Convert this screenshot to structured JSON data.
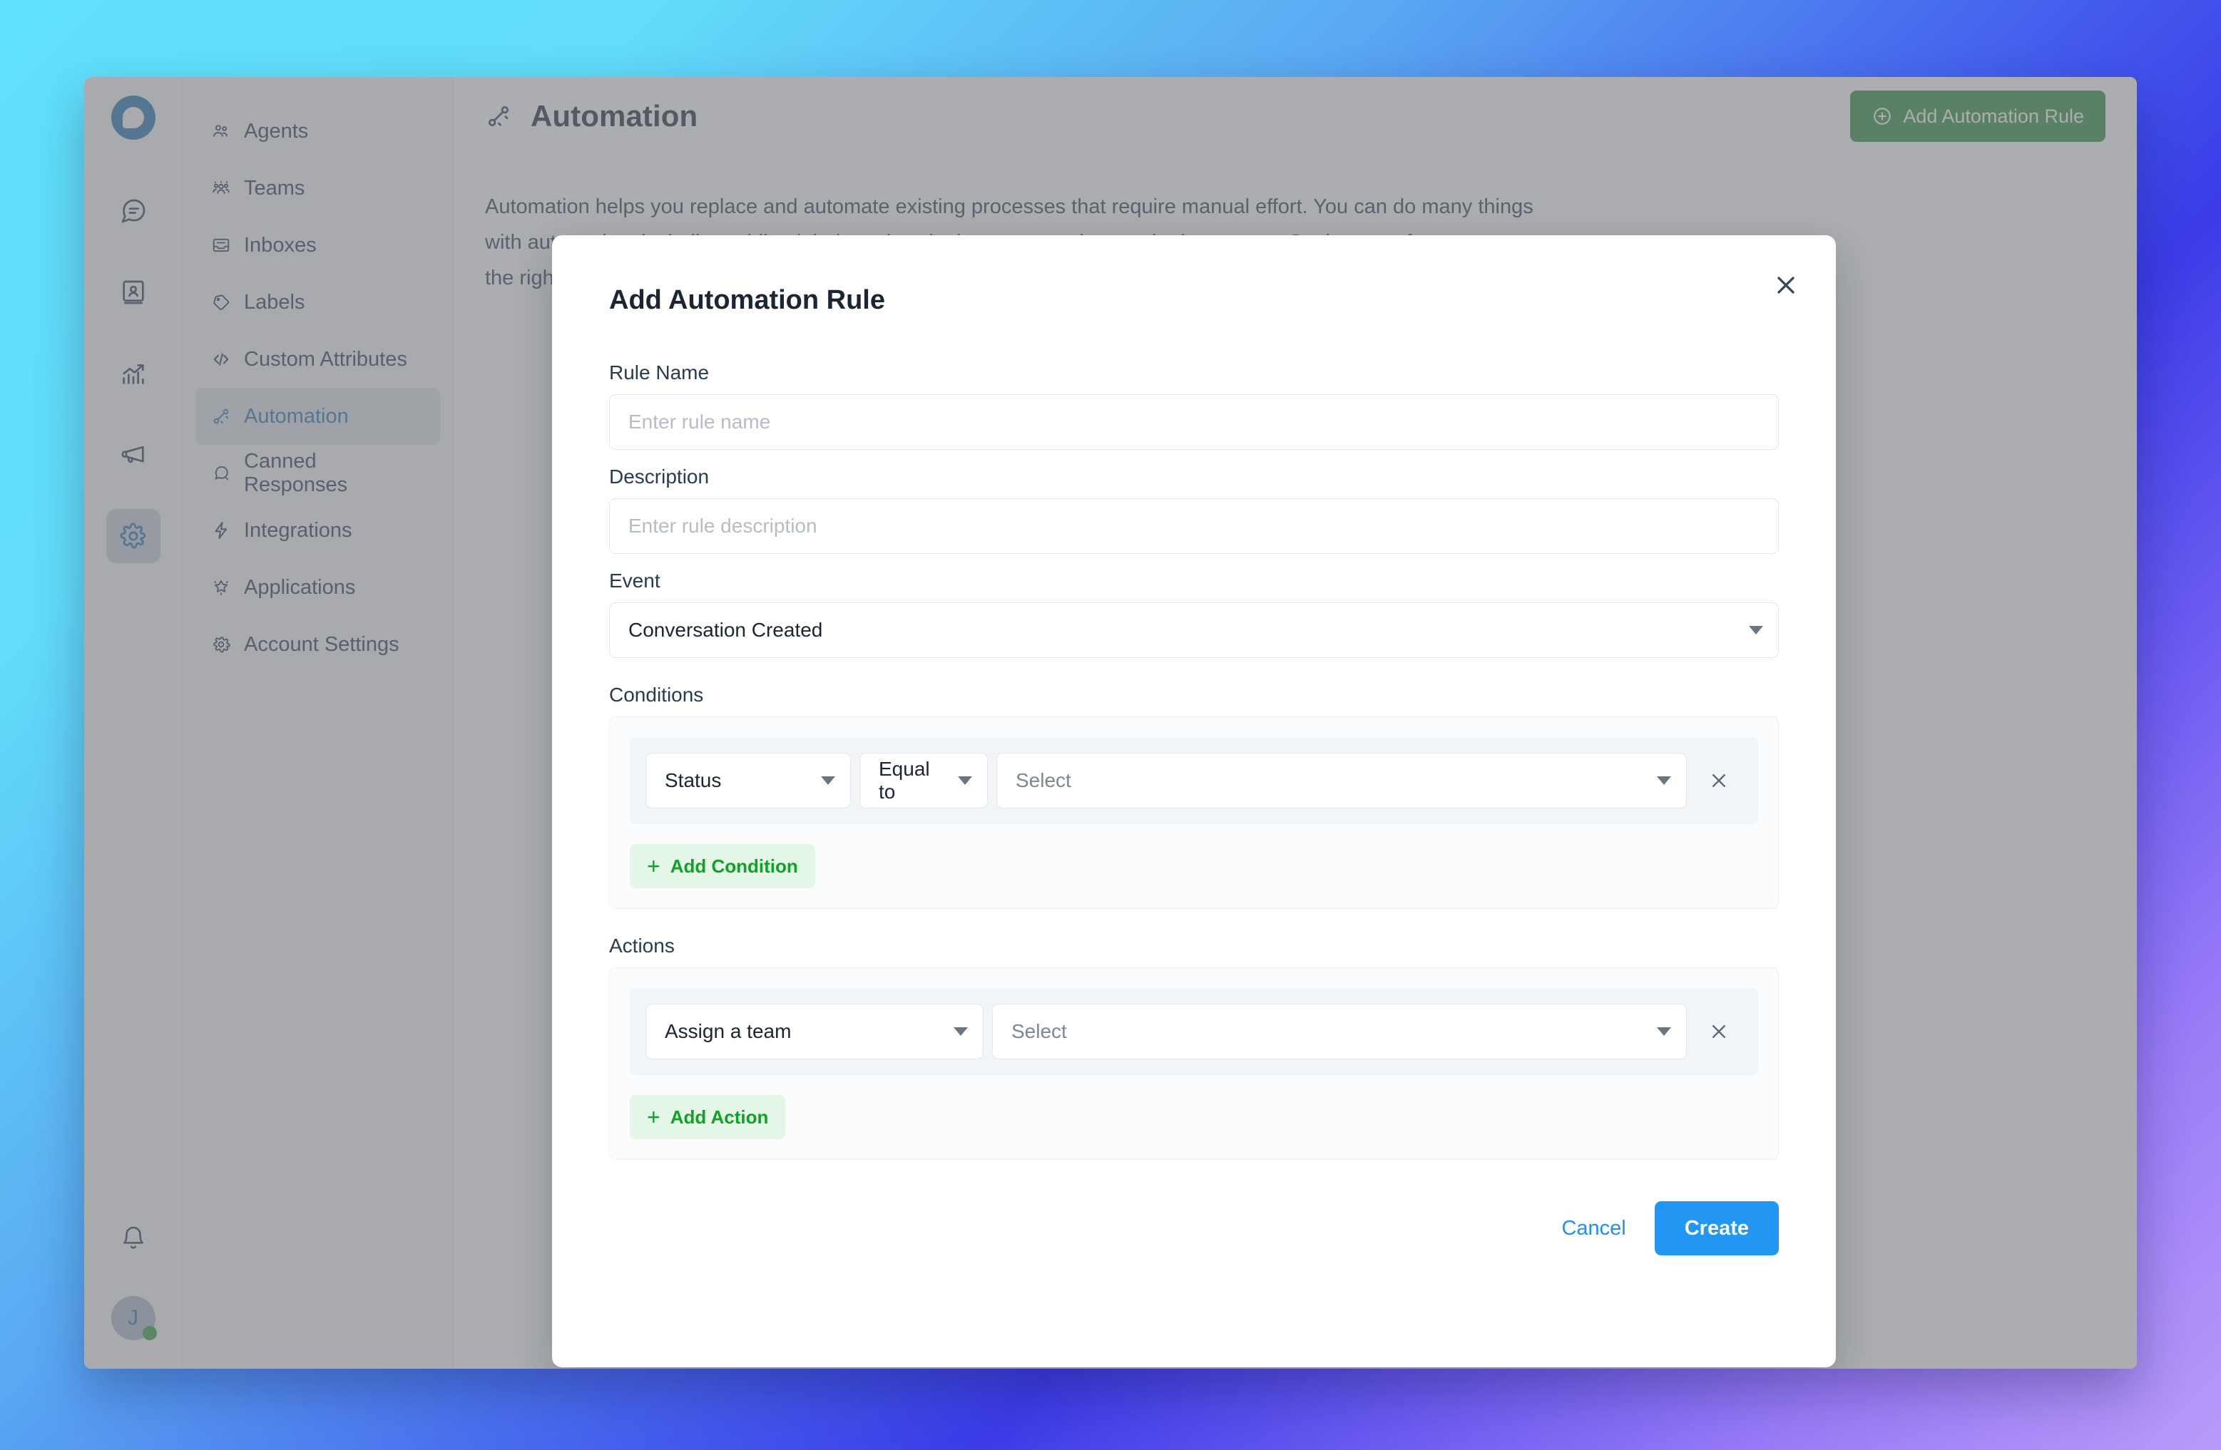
{
  "app": {
    "brand_icon": "chatwoot-logo"
  },
  "rail": {
    "items": [
      {
        "icon": "chat-bubble-icon",
        "name": "conversations",
        "active": false
      },
      {
        "icon": "contact-book-icon",
        "name": "contacts",
        "active": false
      },
      {
        "icon": "report-chart-icon",
        "name": "reports",
        "active": false
      },
      {
        "icon": "megaphone-icon",
        "name": "campaigns",
        "active": false
      },
      {
        "icon": "gear-icon",
        "name": "settings",
        "active": true
      }
    ],
    "bell_icon": "bell-icon",
    "avatar_initial": "J"
  },
  "sidebar": {
    "items": [
      {
        "label": "Agents",
        "icon": "agents-icon",
        "active": false
      },
      {
        "label": "Teams",
        "icon": "teams-icon",
        "active": false
      },
      {
        "label": "Inboxes",
        "icon": "inbox-icon",
        "active": false
      },
      {
        "label": "Labels",
        "icon": "tag-icon",
        "active": false
      },
      {
        "label": "Custom Attributes",
        "icon": "code-icon",
        "active": false
      },
      {
        "label": "Automation",
        "icon": "automation-icon",
        "active": true
      },
      {
        "label": "Canned Responses",
        "icon": "canned-response-icon",
        "active": false
      },
      {
        "label": "Integrations",
        "icon": "bolt-icon",
        "active": false
      },
      {
        "label": "Applications",
        "icon": "star-icon",
        "active": false
      },
      {
        "label": "Account Settings",
        "icon": "gear-icon",
        "active": false
      }
    ]
  },
  "header": {
    "title": "Automation",
    "icon": "automation-icon",
    "add_rule_label": "Add Automation Rule",
    "add_rule_icon": "plus-circle-icon",
    "add_rule_color": "#2a8a3e"
  },
  "main": {
    "body_copy": "Automation helps you replace and automate existing processes that require manual effort. You can do many things with automation, including adding labels and assigning conversations to the best agent. So the team focuses on the right conversations and spends more little time on manual"
  },
  "modal": {
    "title": "Add Automation Rule",
    "close_icon": "close-icon",
    "rule_name": {
      "label": "Rule Name",
      "value": "",
      "placeholder": "Enter rule name"
    },
    "description": {
      "label": "Description",
      "value": "",
      "placeholder": "Enter rule description"
    },
    "event": {
      "label": "Event",
      "selected": "Conversation Created",
      "caret_icon": "chevron-down-icon"
    },
    "conditions": {
      "label": "Conditions",
      "rows": [
        {
          "attribute": "Status",
          "operator": "Equal to",
          "value_placeholder": "Select",
          "remove_icon": "close-icon"
        }
      ],
      "add_label": "Add Condition",
      "add_icon": "plus-icon",
      "add_color": "#12a02b"
    },
    "actions": {
      "label": "Actions",
      "rows": [
        {
          "action": "Assign a team",
          "value_placeholder": "Select",
          "remove_icon": "close-icon"
        }
      ],
      "add_label": "Add Action",
      "add_icon": "plus-icon",
      "add_color": "#12a02b"
    },
    "footer": {
      "cancel_label": "Cancel",
      "create_label": "Create",
      "create_color": "#2196f3",
      "cancel_color": "#1f8efa"
    }
  }
}
